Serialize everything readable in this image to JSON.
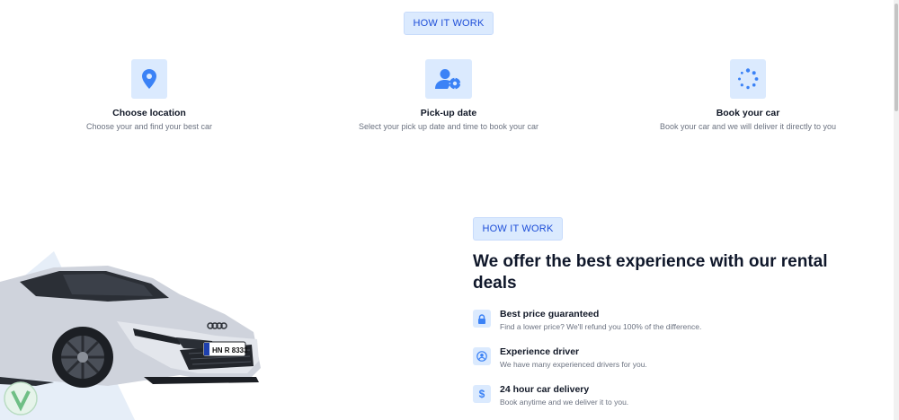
{
  "top_section": {
    "pill_label": "HOW IT WORK",
    "steps": [
      {
        "icon": "location-pin-icon",
        "title": "Choose location",
        "description": "Choose your and find your best car"
      },
      {
        "icon": "user-settings-icon",
        "title": "Pick-up date",
        "description": "Select your pick up date and time to book your car"
      },
      {
        "icon": "loading-dots-icon",
        "title": "Book your car",
        "description": "Book your car and we will deliver it directly to you"
      }
    ]
  },
  "offer_section": {
    "pill_label": "HOW IT WORK",
    "headline": "We offer the best experience with our rental deals",
    "features": [
      {
        "icon": "lock-icon",
        "title": "Best price guaranteed",
        "description": "Find a lower price? We'll refund you 100% of the difference."
      },
      {
        "icon": "user-circle-icon",
        "title": "Experience driver",
        "description": "We have many experienced drivers for you."
      },
      {
        "icon": "dollar-icon",
        "title": "24 hour car delivery",
        "description": "Book anytime and we deliver it to you."
      }
    ],
    "car_plate": "HN R 8333"
  },
  "colors": {
    "accent": "#3b82f6",
    "pill_bg": "#dbeafe",
    "pill_text": "#1d4ed8"
  }
}
